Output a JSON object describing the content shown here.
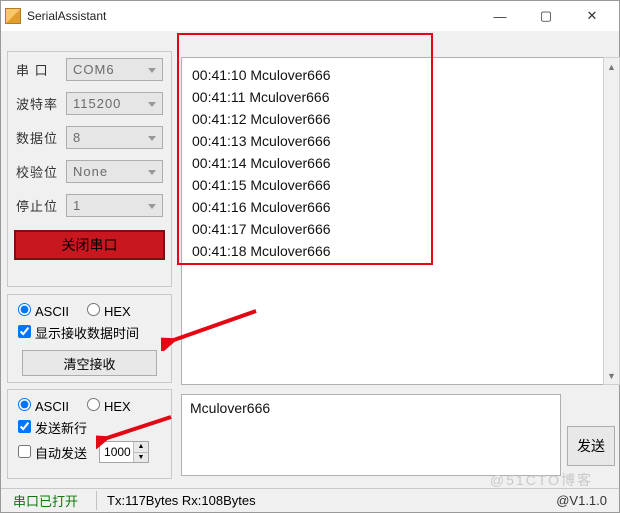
{
  "window": {
    "title": "SerialAssistant"
  },
  "titlebar_buttons": {
    "min": "—",
    "max": "▢",
    "close": "✕"
  },
  "config": {
    "port_label": "串  口",
    "baud_label": "波特率",
    "data_label": "数据位",
    "parity_label": "校验位",
    "stop_label": "停止位",
    "port_value": "COM6",
    "baud_value": "115200",
    "data_value": "8",
    "parity_value": "None",
    "stop_value": "1",
    "close_port_btn": "关闭串口"
  },
  "rx": {
    "lines": [
      "00:41:10  Mculover666",
      "00:41:11  Mculover666",
      "00:41:12  Mculover666",
      "00:41:13  Mculover666",
      "00:41:14  Mculover666",
      "00:41:15  Mculover666",
      "00:41:16  Mculover666",
      "00:41:17  Mculover666",
      "00:41:18  Mculover666"
    ]
  },
  "rxopt": {
    "ascii": "ASCII",
    "hex": "HEX",
    "show_time": "显示接收数据时间",
    "clear_btn": "清空接收"
  },
  "txopt": {
    "ascii": "ASCII",
    "hex": "HEX",
    "send_newline": "发送新行",
    "auto_send": "自动发送",
    "interval": "1000"
  },
  "send": {
    "text": "Mculover666",
    "btn": "发送"
  },
  "status": {
    "port_state": "串口已打开",
    "bytes": "Tx:117Bytes Rx:108Bytes",
    "version": "@V1.1.0"
  },
  "watermark": "@51CTO博客"
}
